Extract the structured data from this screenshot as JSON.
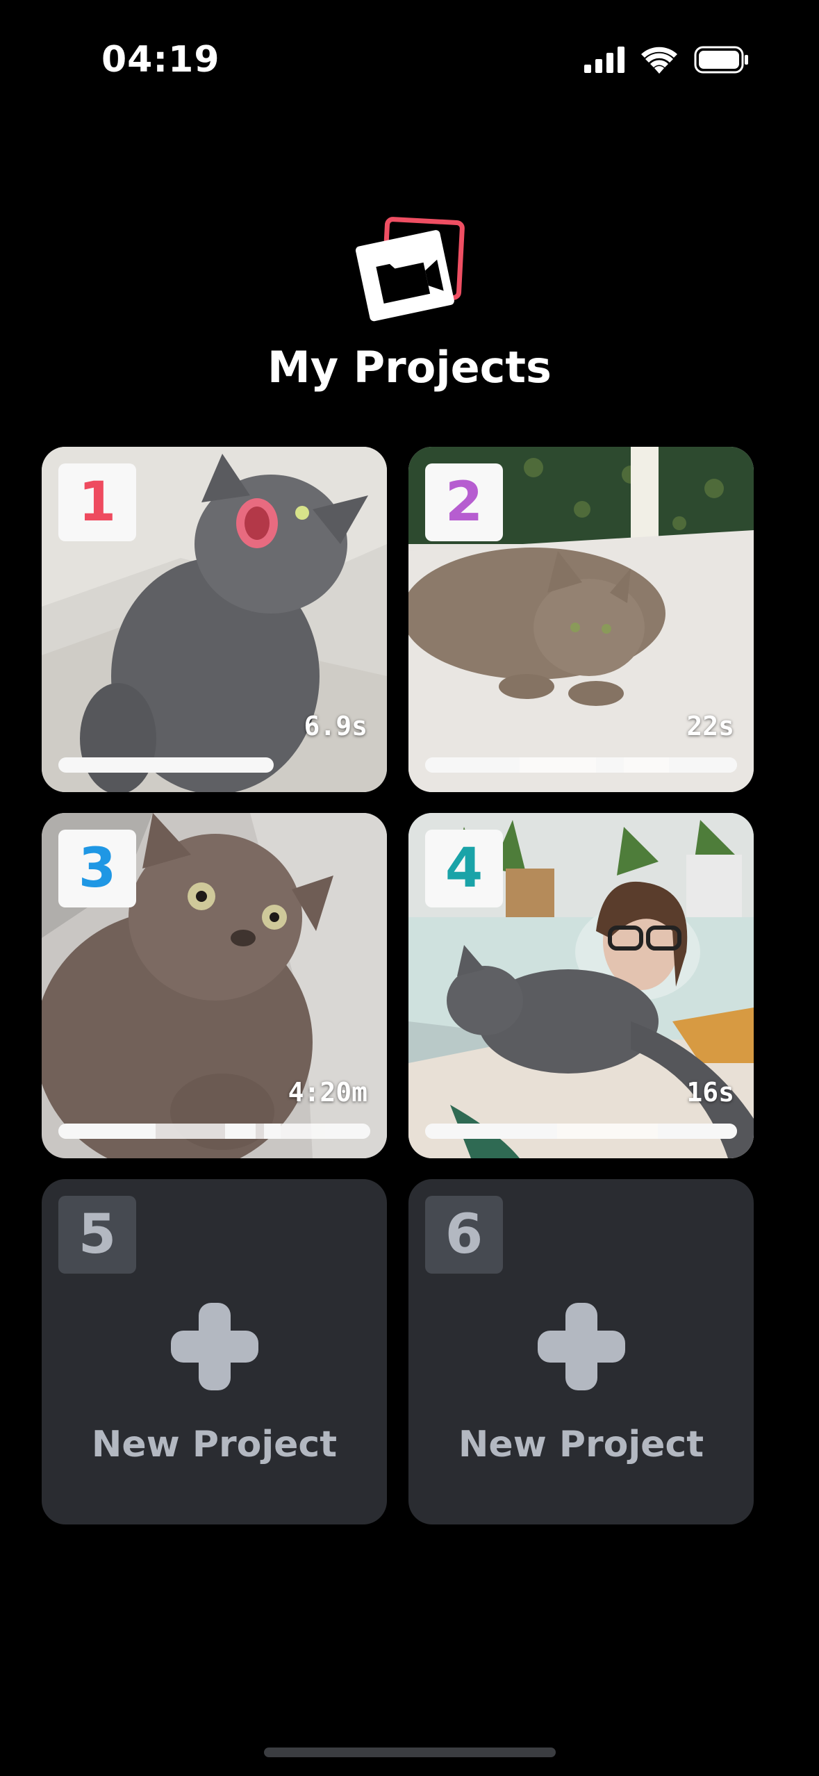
{
  "status_bar": {
    "time": "04:19",
    "icons": [
      "cellular-signal-icon",
      "wifi-icon",
      "battery-icon"
    ]
  },
  "header": {
    "logo_icon": "video-folder-logo-icon",
    "title": "My Projects"
  },
  "colors": {
    "background": "#000000",
    "empty_card": "#2a2c31",
    "empty_text": "#b3b8c1",
    "project_1": "#ee4b5f",
    "project_2": "#b65dd0",
    "project_3": "#1f97e4",
    "project_4": "#1aa3a8",
    "logo_accent": "#ef4f63"
  },
  "projects": [
    {
      "number": "1",
      "duration": "6.9s",
      "thumbnail": "gray cat meowing on couch",
      "progress_segments": [
        "solid"
      ]
    },
    {
      "number": "2",
      "duration": "22s",
      "thumbnail": "gray cat lying on bed",
      "progress_segments": [
        "solid",
        "light",
        "solid",
        "light",
        "solid"
      ]
    },
    {
      "number": "3",
      "duration": "4:20m",
      "thumbnail": "gray cat looking up",
      "progress_segments": [
        "solid",
        "light",
        "solid",
        "light",
        "solid",
        "light",
        "solid"
      ]
    },
    {
      "number": "4",
      "duration": "16s",
      "thumbnail": "person on couch with gray cat",
      "progress_segments": [
        "solid",
        "light",
        "solid"
      ]
    }
  ],
  "empty_slots": [
    {
      "number": "5",
      "label": "New Project",
      "icon": "plus-icon"
    },
    {
      "number": "6",
      "label": "New Project",
      "icon": "plus-icon"
    }
  ]
}
